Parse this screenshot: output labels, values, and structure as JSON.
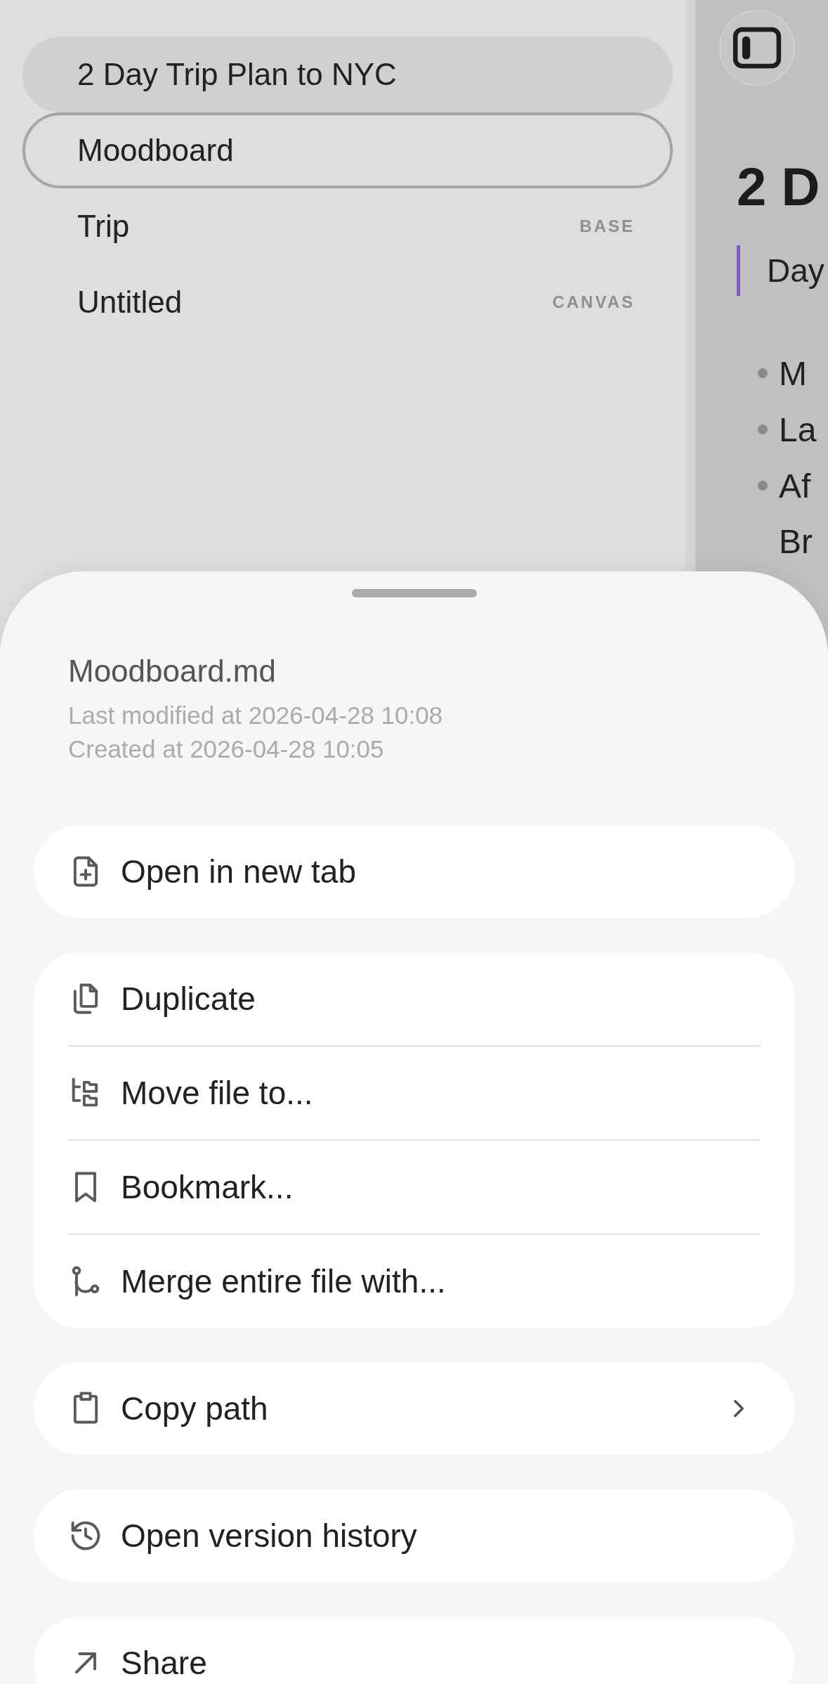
{
  "sidebar": {
    "items": [
      {
        "label": "2 Day Trip Plan to NYC",
        "selected": true,
        "outlined": false
      },
      {
        "label": "Moodboard",
        "selected": false,
        "outlined": true
      },
      {
        "label": "Trip",
        "badge": "BASE",
        "selected": false,
        "outlined": false
      },
      {
        "label": "Untitled",
        "badge": "CANVAS",
        "selected": false,
        "outlined": false
      }
    ]
  },
  "editor": {
    "heading": "2 D",
    "quote": "Day",
    "bullets": [
      "M",
      "La",
      "Af"
    ],
    "continuation": "Br"
  },
  "sheet": {
    "title": "Moodboard.md",
    "meta": [
      "Last modified at 2026-04-28 10:08",
      "Created at 2026-04-28 10:05"
    ],
    "groups": [
      {
        "items": [
          {
            "kind": "new-tab",
            "label": "Open in new tab",
            "submenu": false
          }
        ]
      },
      {
        "items": [
          {
            "kind": "duplicate",
            "label": "Duplicate",
            "submenu": false
          },
          {
            "kind": "move",
            "label": "Move file to...",
            "submenu": false
          },
          {
            "kind": "bookmark",
            "label": "Bookmark...",
            "submenu": false
          },
          {
            "kind": "merge",
            "label": "Merge entire file with...",
            "submenu": false
          }
        ]
      },
      {
        "items": [
          {
            "kind": "copy-path",
            "label": "Copy path",
            "submenu": true
          }
        ]
      },
      {
        "items": [
          {
            "kind": "history",
            "label": "Open version history",
            "submenu": false
          }
        ]
      },
      {
        "items": [
          {
            "kind": "share",
            "label": "Share",
            "submenu": false
          }
        ]
      }
    ]
  }
}
